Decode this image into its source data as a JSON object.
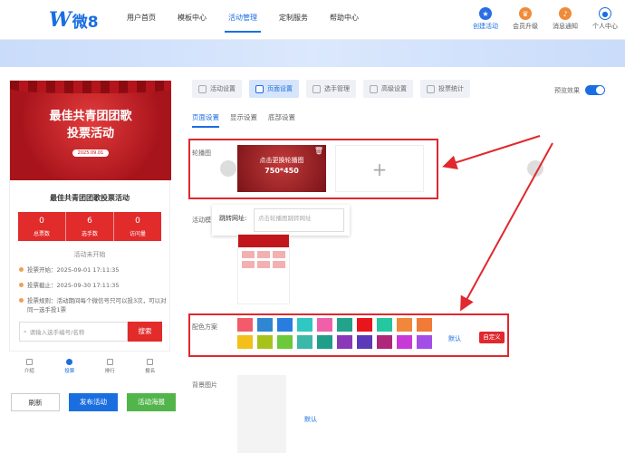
{
  "header": {
    "logo_mark": "W",
    "logo_text": "微8",
    "nav": [
      "用户首页",
      "模板中心",
      "活动管理",
      "定制服务",
      "帮助中心"
    ],
    "active_nav": 2,
    "icons": [
      {
        "label": "创建活动",
        "icon": "star-icon",
        "color": "#2a6de6"
      },
      {
        "label": "会员升级",
        "icon": "crown-icon",
        "color": "#f08b3a"
      },
      {
        "label": "消息通知",
        "icon": "bell-icon",
        "color": "#f08b3a"
      },
      {
        "label": "个人中心",
        "icon": "user-icon",
        "color": "#1a6ee0"
      }
    ]
  },
  "preview": {
    "poster_title_line1": "最佳共青团团歌",
    "poster_title_line2": "投票活动",
    "poster_date": "2025.09.01",
    "activity_title": "最佳共青团团歌投票活动",
    "stats": [
      {
        "num": "0",
        "label": "总票数"
      },
      {
        "num": "6",
        "label": "选手数"
      },
      {
        "num": "0",
        "label": "访问量"
      }
    ],
    "status": "活动未开始",
    "vote_start": "投票开始：2025-09-01 17:11:35",
    "vote_end": "投票截止：2025-09-30 17:11:35",
    "vote_rule": "投票规则：活动期间每个微信号只可以投3次，可以对同一选手投1票",
    "search_placeholder": "请输入选手编号/名称",
    "search_button": "搜索",
    "tabs": [
      "介绍",
      "投票",
      "排行",
      "报名"
    ],
    "active_tab": 1,
    "buttons": {
      "refresh": "刷新",
      "publish": "发布活动",
      "poster": "活动海报"
    }
  },
  "settings": {
    "steps": [
      "活动设置",
      "页面设置",
      "选手管理",
      "高级设置",
      "投票统计"
    ],
    "active_step": 1,
    "preview_toggle_label": "预览效果",
    "subtabs": [
      "页面设置",
      "显示设置",
      "底部设置"
    ],
    "active_subtab": 0,
    "carousel_label": "轮播图",
    "carousel_thumb_line1": "点击更换轮播图",
    "carousel_thumb_line2": "750*450",
    "activity_label": "活动模",
    "jump_label": "跳转网址:",
    "jump_placeholder": "点击轮播图跳转网址",
    "color_label": "配色方案",
    "color_default": "默认",
    "color_custom": "自定义",
    "bg_label": "背景图片",
    "bg_default": "默认",
    "swatches": [
      "#f25c6a",
      "#2f86d1",
      "#2a7de0",
      "#2fc7c2",
      "#f060a8",
      "#23a38a",
      "#e8161c",
      "#25c7a0",
      "#f0873a",
      "#f07a36",
      "#f2c018",
      "#a8c21c",
      "#6cc93a",
      "#3cb8a8",
      "#1f9e8a",
      "#8a38b8",
      "#5a3ab8",
      "#b0267a",
      "#c83ad8",
      "#a44ee8"
    ]
  }
}
